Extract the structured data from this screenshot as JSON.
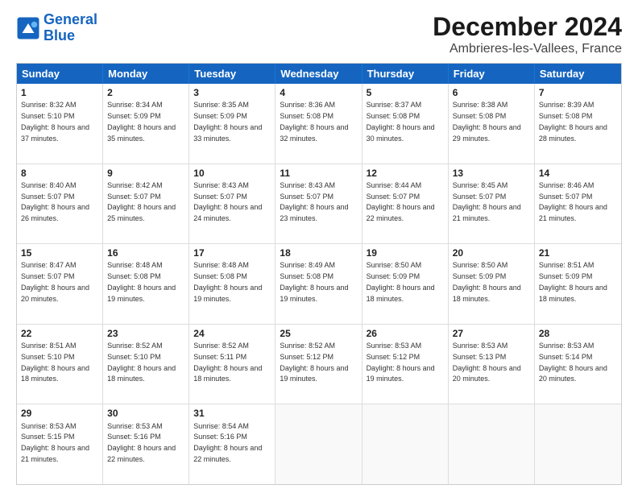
{
  "logo": {
    "line1": "General",
    "line2": "Blue"
  },
  "header": {
    "month": "December 2024",
    "location": "Ambrieres-les-Vallees, France"
  },
  "days": [
    "Sunday",
    "Monday",
    "Tuesday",
    "Wednesday",
    "Thursday",
    "Friday",
    "Saturday"
  ],
  "weeks": [
    [
      {
        "day": 1,
        "sunrise": "8:32 AM",
        "sunset": "5:10 PM",
        "daylight": "8 hours and 37 minutes."
      },
      {
        "day": 2,
        "sunrise": "8:34 AM",
        "sunset": "5:09 PM",
        "daylight": "8 hours and 35 minutes."
      },
      {
        "day": 3,
        "sunrise": "8:35 AM",
        "sunset": "5:09 PM",
        "daylight": "8 hours and 33 minutes."
      },
      {
        "day": 4,
        "sunrise": "8:36 AM",
        "sunset": "5:08 PM",
        "daylight": "8 hours and 32 minutes."
      },
      {
        "day": 5,
        "sunrise": "8:37 AM",
        "sunset": "5:08 PM",
        "daylight": "8 hours and 30 minutes."
      },
      {
        "day": 6,
        "sunrise": "8:38 AM",
        "sunset": "5:08 PM",
        "daylight": "8 hours and 29 minutes."
      },
      {
        "day": 7,
        "sunrise": "8:39 AM",
        "sunset": "5:08 PM",
        "daylight": "8 hours and 28 minutes."
      }
    ],
    [
      {
        "day": 8,
        "sunrise": "8:40 AM",
        "sunset": "5:07 PM",
        "daylight": "8 hours and 26 minutes."
      },
      {
        "day": 9,
        "sunrise": "8:42 AM",
        "sunset": "5:07 PM",
        "daylight": "8 hours and 25 minutes."
      },
      {
        "day": 10,
        "sunrise": "8:43 AM",
        "sunset": "5:07 PM",
        "daylight": "8 hours and 24 minutes."
      },
      {
        "day": 11,
        "sunrise": "8:43 AM",
        "sunset": "5:07 PM",
        "daylight": "8 hours and 23 minutes."
      },
      {
        "day": 12,
        "sunrise": "8:44 AM",
        "sunset": "5:07 PM",
        "daylight": "8 hours and 22 minutes."
      },
      {
        "day": 13,
        "sunrise": "8:45 AM",
        "sunset": "5:07 PM",
        "daylight": "8 hours and 21 minutes."
      },
      {
        "day": 14,
        "sunrise": "8:46 AM",
        "sunset": "5:07 PM",
        "daylight": "8 hours and 21 minutes."
      }
    ],
    [
      {
        "day": 15,
        "sunrise": "8:47 AM",
        "sunset": "5:07 PM",
        "daylight": "8 hours and 20 minutes."
      },
      {
        "day": 16,
        "sunrise": "8:48 AM",
        "sunset": "5:08 PM",
        "daylight": "8 hours and 19 minutes."
      },
      {
        "day": 17,
        "sunrise": "8:48 AM",
        "sunset": "5:08 PM",
        "daylight": "8 hours and 19 minutes."
      },
      {
        "day": 18,
        "sunrise": "8:49 AM",
        "sunset": "5:08 PM",
        "daylight": "8 hours and 19 minutes."
      },
      {
        "day": 19,
        "sunrise": "8:50 AM",
        "sunset": "5:09 PM",
        "daylight": "8 hours and 18 minutes."
      },
      {
        "day": 20,
        "sunrise": "8:50 AM",
        "sunset": "5:09 PM",
        "daylight": "8 hours and 18 minutes."
      },
      {
        "day": 21,
        "sunrise": "8:51 AM",
        "sunset": "5:09 PM",
        "daylight": "8 hours and 18 minutes."
      }
    ],
    [
      {
        "day": 22,
        "sunrise": "8:51 AM",
        "sunset": "5:10 PM",
        "daylight": "8 hours and 18 minutes."
      },
      {
        "day": 23,
        "sunrise": "8:52 AM",
        "sunset": "5:10 PM",
        "daylight": "8 hours and 18 minutes."
      },
      {
        "day": 24,
        "sunrise": "8:52 AM",
        "sunset": "5:11 PM",
        "daylight": "8 hours and 18 minutes."
      },
      {
        "day": 25,
        "sunrise": "8:52 AM",
        "sunset": "5:12 PM",
        "daylight": "8 hours and 19 minutes."
      },
      {
        "day": 26,
        "sunrise": "8:53 AM",
        "sunset": "5:12 PM",
        "daylight": "8 hours and 19 minutes."
      },
      {
        "day": 27,
        "sunrise": "8:53 AM",
        "sunset": "5:13 PM",
        "daylight": "8 hours and 20 minutes."
      },
      {
        "day": 28,
        "sunrise": "8:53 AM",
        "sunset": "5:14 PM",
        "daylight": "8 hours and 20 minutes."
      }
    ],
    [
      {
        "day": 29,
        "sunrise": "8:53 AM",
        "sunset": "5:15 PM",
        "daylight": "8 hours and 21 minutes."
      },
      {
        "day": 30,
        "sunrise": "8:53 AM",
        "sunset": "5:16 PM",
        "daylight": "8 hours and 22 minutes."
      },
      {
        "day": 31,
        "sunrise": "8:54 AM",
        "sunset": "5:16 PM",
        "daylight": "8 hours and 22 minutes."
      },
      null,
      null,
      null,
      null
    ]
  ]
}
